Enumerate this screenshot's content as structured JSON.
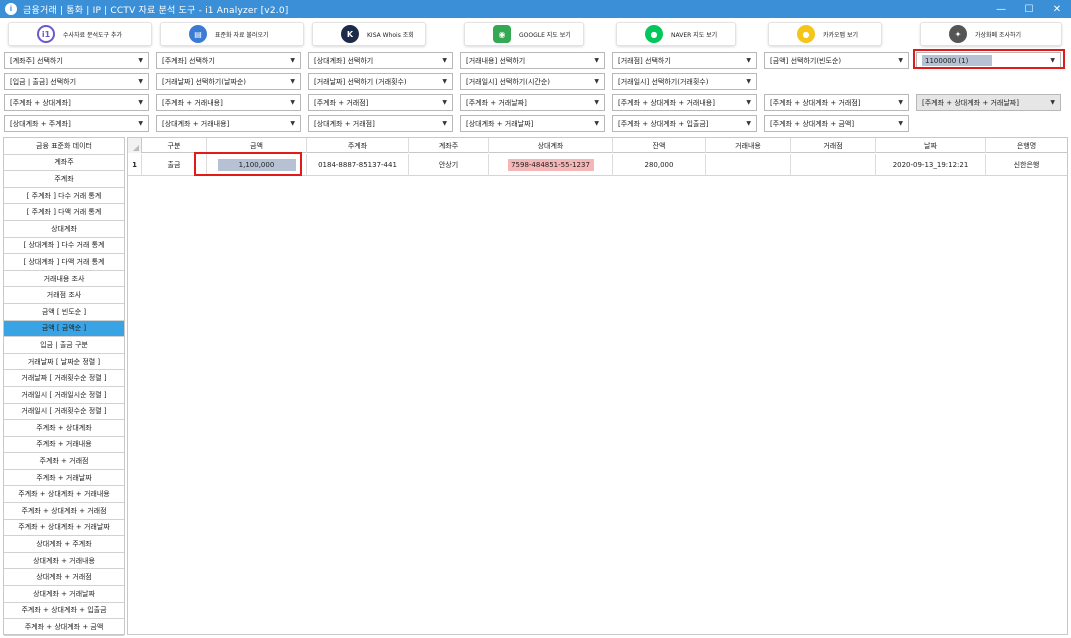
{
  "window": {
    "title": "금융거래 | 통화 | IP | CCTV 자료 분석 도구 - i1 Analyzer [v2.0]",
    "minimize": "—",
    "maximize": "☐",
    "close": "✕"
  },
  "tools": [
    {
      "label": "수사자료 분석도구 추가",
      "icon": "i1-logo-icon",
      "glyph": "i1",
      "color": "#6a5acd"
    },
    {
      "label": "표준화 자료 불러오기",
      "icon": "document-icon",
      "glyph": "▤",
      "color": "#3a7bd5"
    },
    {
      "label": "KISA Whois 조회",
      "icon": "kisa-logo-icon",
      "glyph": "K",
      "color": "#1c2b4a"
    },
    {
      "label": "GOOGLE 지도 보기",
      "icon": "google-maps-icon",
      "glyph": "◉",
      "color": "#34a853"
    },
    {
      "label": "NAVER 지도 보기",
      "icon": "naver-map-icon",
      "glyph": "●",
      "color": "#03c75a"
    },
    {
      "label": "카카오맵 보기",
      "icon": "kakao-map-icon",
      "glyph": "●",
      "color": "#f5c518"
    },
    {
      "label": "가상화폐 조사하기",
      "icon": "crypto-icon",
      "glyph": "✦",
      "color": "#555555"
    }
  ],
  "selectors": {
    "row1": [
      "[계좌주] 선택하기",
      "[주계좌] 선택하기",
      "[상대계좌] 선택하기",
      "[거래내용] 선택하기",
      "[거래점] 선택하기",
      "[금액] 선택하기(빈도순)",
      "1100000 (1)"
    ],
    "row2": [
      "[입금 | 출금] 선택하기",
      "[거래날짜] 선택하기(날짜순)",
      "[거래날짜] 선택하기 (거래횟수)",
      "[거래일시] 선택하기(시간순)",
      "[거래일시] 선택하기(거래횟수)"
    ],
    "row3": [
      "[주계좌 + 상대계좌]",
      "[주계좌 + 거래내용]",
      "[주계좌 + 거래점]",
      "[주계좌 + 거래날짜]",
      "[주계좌 + 상대계좌 + 거래내용]",
      "[주계좌 + 상대계좌 + 거래점]",
      "[주계좌 + 상대계좌 + 거래날짜]"
    ],
    "row4": [
      "[상대계좌 + 주계좌]",
      "[상대계좌 + 거래내용]",
      "[상대계좌 + 거래점]",
      "[상대계좌 + 거래날짜]",
      "[주계좌 + 상대계좌 + 입출금]",
      "[주계좌 + 상대계좌 + 금액]"
    ]
  },
  "sidemenu": [
    "금융 표준화 데이터",
    "계좌주",
    "주계좌",
    "[ 주계좌 ] 다수 거래 통계",
    "[ 주계좌 ] 다액 거래 통계",
    "상대계좌",
    "[ 상대계좌 ] 다수 거래 통계",
    "[ 상대계좌 ] 다액 거래 통계",
    "거래내용 조사",
    "거래점 조사",
    "금액 [ 빈도순 ]",
    "금액 [ 금액순 ]",
    "입금 | 출금 구분",
    "거래날짜 [ 날짜순 정렬 ]",
    "거래날짜 [ 거래횟수순 정렬 ]",
    "거래일시 [ 거래일시순 정렬 ]",
    "거래일시 [ 거래횟수순 정렬 ]",
    "주계좌 + 상대계좌",
    "주계좌 + 거래내용",
    "주계좌 + 거래점",
    "주계좌 + 거래날짜",
    "주계좌 + 상대계좌 + 거래내용",
    "주계좌 + 상대계좌 + 거래점",
    "주계좌 + 상대계좌 + 거래날짜",
    "상대계좌 + 주계좌",
    "상대계좌 + 거래내용",
    "상대계좌 + 거래점",
    "상대계좌 + 거래날짜",
    "주계좌 + 상대계좌 + 입출금",
    "주계좌 + 상대계좌 + 금액"
  ],
  "sidemenu_active_index": 11,
  "grid": {
    "columns": [
      "구분",
      "금액",
      "주계좌",
      "계좌주",
      "상대계좌",
      "잔액",
      "거래내용",
      "거래점",
      "날짜",
      "은행명"
    ],
    "rows": [
      {
        "no": "1",
        "cells": [
          "출금",
          "1,100,000",
          "0184-8887-85137-441",
          "안상기",
          "7598-484851-55-1237",
          "280,000",
          "",
          "",
          "2020-09-13_19:12:21",
          "신한은행"
        ]
      }
    ]
  },
  "colors": {
    "titlebar": "#3b8fd6",
    "active_menu": "#3aa3e3",
    "highlight_red": "#e11a1a",
    "amount_cell": "#b6c2d4",
    "counter_account_cell": "#f4b6b6"
  }
}
